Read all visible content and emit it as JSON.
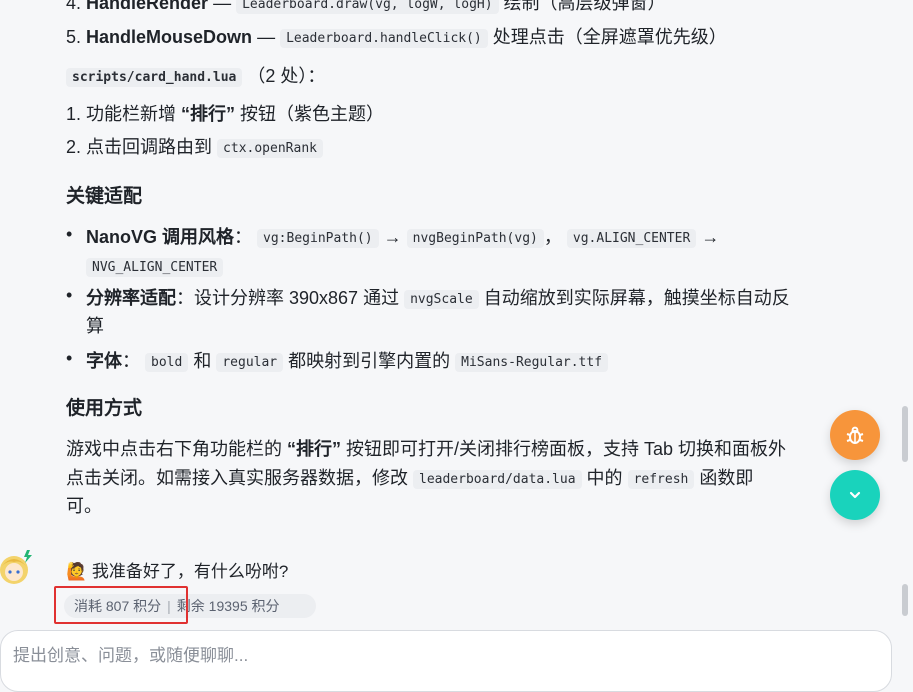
{
  "items": {
    "i4": {
      "num": "4.",
      "title": "HandleRender",
      "dash": "—",
      "code": "Leaderboard.draw(vg, logW, logH)",
      "text": "绘制（高层级弹窗）"
    },
    "i5": {
      "num": "5.",
      "title": "HandleMouseDown",
      "dash": "—",
      "code": "Leaderboard.handleClick()",
      "text": "处理点击（全屏遮罩优先级）"
    }
  },
  "file_line": {
    "code": "scripts/card_hand.lua",
    "text": "（2 处）："
  },
  "file_items": [
    {
      "num": "1.",
      "pre": "功能栏新增 ",
      "bold": "“排行”",
      "post": " 按钮（紫色主题）"
    },
    {
      "num": "2.",
      "pre": "点击回调路由到 ",
      "code": "ctx.openRank"
    }
  ],
  "section_adapt": {
    "heading": "关键适配",
    "b1": {
      "label": "NanoVG 调用风格",
      "colon": "：",
      "c1": "vg:BeginPath()",
      "arrow1": "→",
      "c2": "nvgBeginPath(vg)",
      "sep": "，",
      "c3": "vg.ALIGN_CENTER",
      "arrow2": "→",
      "c4": "NVG_ALIGN_CENTER"
    },
    "b2": {
      "label": "分辨率适配",
      "colon": "：",
      "t1": "设计分辨率 390x867 通过 ",
      "code": "nvgScale",
      "t2": " 自动缩放到实际屏幕，触摸坐标自动反",
      "t3": "算"
    },
    "b3": {
      "label": "字体",
      "colon": "：",
      "c1": "bold",
      "t1": " 和 ",
      "c2": "regular",
      "t2": " 都映射到引擎内置的 ",
      "c3": "MiSans-Regular.ttf"
    }
  },
  "section_usage": {
    "heading": "使用方式",
    "l1_pre": "游戏中点击右下角功能栏的 ",
    "l1_bold": "“排行”",
    "l1_post": " 按钮即可打开/关闭排行榜面板，支持 Tab 切换和面板外",
    "l2_pre": "点击关闭。如需接入真实服务器数据，修改 ",
    "l2_code1": "leaderboard/data.lua",
    "l2_mid": " 中的 ",
    "l2_code2": "refresh",
    "l2_post": " 函数即",
    "l3": "可。"
  },
  "reply": {
    "emoji": "🙋",
    "text": "我准备好了，有什么吩咐?"
  },
  "stats": {
    "cost": "消耗 807 积分",
    "divider": "|",
    "remain": "剩余 19395 积分"
  },
  "input": {
    "placeholder": "提出创意、问题，或随便聊聊..."
  },
  "colors": {
    "fab_bug": "#f7953b",
    "fab_down": "#19d3bc",
    "highlight": "#e03131"
  },
  "icons": {
    "fab_bug": "bug-icon",
    "fab_down": "chevron-down-icon",
    "avatar": "avatar"
  }
}
